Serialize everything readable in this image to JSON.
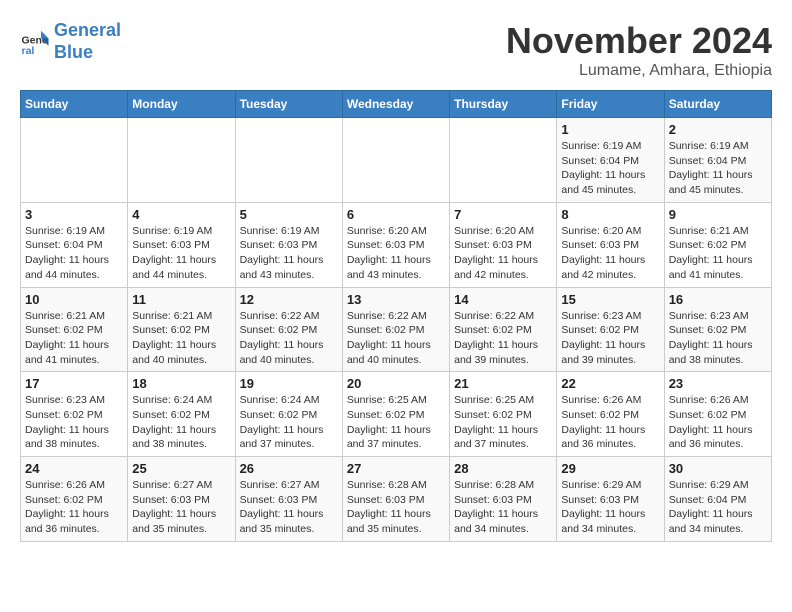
{
  "logo": {
    "line1": "General",
    "line2": "Blue"
  },
  "title": "November 2024",
  "subtitle": "Lumame, Amhara, Ethiopia",
  "days_of_week": [
    "Sunday",
    "Monday",
    "Tuesday",
    "Wednesday",
    "Thursday",
    "Friday",
    "Saturday"
  ],
  "weeks": [
    [
      {
        "day": "",
        "info": ""
      },
      {
        "day": "",
        "info": ""
      },
      {
        "day": "",
        "info": ""
      },
      {
        "day": "",
        "info": ""
      },
      {
        "day": "",
        "info": ""
      },
      {
        "day": "1",
        "info": "Sunrise: 6:19 AM\nSunset: 6:04 PM\nDaylight: 11 hours and 45 minutes."
      },
      {
        "day": "2",
        "info": "Sunrise: 6:19 AM\nSunset: 6:04 PM\nDaylight: 11 hours and 45 minutes."
      }
    ],
    [
      {
        "day": "3",
        "info": "Sunrise: 6:19 AM\nSunset: 6:04 PM\nDaylight: 11 hours and 44 minutes."
      },
      {
        "day": "4",
        "info": "Sunrise: 6:19 AM\nSunset: 6:03 PM\nDaylight: 11 hours and 44 minutes."
      },
      {
        "day": "5",
        "info": "Sunrise: 6:19 AM\nSunset: 6:03 PM\nDaylight: 11 hours and 43 minutes."
      },
      {
        "day": "6",
        "info": "Sunrise: 6:20 AM\nSunset: 6:03 PM\nDaylight: 11 hours and 43 minutes."
      },
      {
        "day": "7",
        "info": "Sunrise: 6:20 AM\nSunset: 6:03 PM\nDaylight: 11 hours and 42 minutes."
      },
      {
        "day": "8",
        "info": "Sunrise: 6:20 AM\nSunset: 6:03 PM\nDaylight: 11 hours and 42 minutes."
      },
      {
        "day": "9",
        "info": "Sunrise: 6:21 AM\nSunset: 6:02 PM\nDaylight: 11 hours and 41 minutes."
      }
    ],
    [
      {
        "day": "10",
        "info": "Sunrise: 6:21 AM\nSunset: 6:02 PM\nDaylight: 11 hours and 41 minutes."
      },
      {
        "day": "11",
        "info": "Sunrise: 6:21 AM\nSunset: 6:02 PM\nDaylight: 11 hours and 40 minutes."
      },
      {
        "day": "12",
        "info": "Sunrise: 6:22 AM\nSunset: 6:02 PM\nDaylight: 11 hours and 40 minutes."
      },
      {
        "day": "13",
        "info": "Sunrise: 6:22 AM\nSunset: 6:02 PM\nDaylight: 11 hours and 40 minutes."
      },
      {
        "day": "14",
        "info": "Sunrise: 6:22 AM\nSunset: 6:02 PM\nDaylight: 11 hours and 39 minutes."
      },
      {
        "day": "15",
        "info": "Sunrise: 6:23 AM\nSunset: 6:02 PM\nDaylight: 11 hours and 39 minutes."
      },
      {
        "day": "16",
        "info": "Sunrise: 6:23 AM\nSunset: 6:02 PM\nDaylight: 11 hours and 38 minutes."
      }
    ],
    [
      {
        "day": "17",
        "info": "Sunrise: 6:23 AM\nSunset: 6:02 PM\nDaylight: 11 hours and 38 minutes."
      },
      {
        "day": "18",
        "info": "Sunrise: 6:24 AM\nSunset: 6:02 PM\nDaylight: 11 hours and 38 minutes."
      },
      {
        "day": "19",
        "info": "Sunrise: 6:24 AM\nSunset: 6:02 PM\nDaylight: 11 hours and 37 minutes."
      },
      {
        "day": "20",
        "info": "Sunrise: 6:25 AM\nSunset: 6:02 PM\nDaylight: 11 hours and 37 minutes."
      },
      {
        "day": "21",
        "info": "Sunrise: 6:25 AM\nSunset: 6:02 PM\nDaylight: 11 hours and 37 minutes."
      },
      {
        "day": "22",
        "info": "Sunrise: 6:26 AM\nSunset: 6:02 PM\nDaylight: 11 hours and 36 minutes."
      },
      {
        "day": "23",
        "info": "Sunrise: 6:26 AM\nSunset: 6:02 PM\nDaylight: 11 hours and 36 minutes."
      }
    ],
    [
      {
        "day": "24",
        "info": "Sunrise: 6:26 AM\nSunset: 6:02 PM\nDaylight: 11 hours and 36 minutes."
      },
      {
        "day": "25",
        "info": "Sunrise: 6:27 AM\nSunset: 6:03 PM\nDaylight: 11 hours and 35 minutes."
      },
      {
        "day": "26",
        "info": "Sunrise: 6:27 AM\nSunset: 6:03 PM\nDaylight: 11 hours and 35 minutes."
      },
      {
        "day": "27",
        "info": "Sunrise: 6:28 AM\nSunset: 6:03 PM\nDaylight: 11 hours and 35 minutes."
      },
      {
        "day": "28",
        "info": "Sunrise: 6:28 AM\nSunset: 6:03 PM\nDaylight: 11 hours and 34 minutes."
      },
      {
        "day": "29",
        "info": "Sunrise: 6:29 AM\nSunset: 6:03 PM\nDaylight: 11 hours and 34 minutes."
      },
      {
        "day": "30",
        "info": "Sunrise: 6:29 AM\nSunset: 6:04 PM\nDaylight: 11 hours and 34 minutes."
      }
    ]
  ]
}
